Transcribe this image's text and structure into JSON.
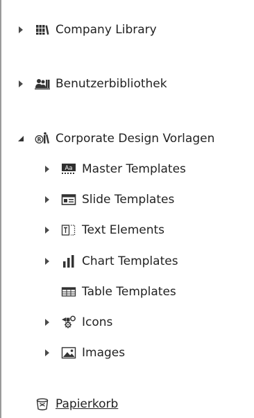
{
  "tree": {
    "libraries": [
      {
        "label": "Company Library",
        "icon": "books-icon",
        "expanded": false
      },
      {
        "label": "Benutzerbibliothek",
        "icon": "users-library-icon",
        "expanded": false
      },
      {
        "label": "Corporate Design Vorlagen",
        "icon": "corporate-design-icon",
        "expanded": true
      }
    ],
    "children": [
      {
        "label": "Master Templates",
        "icon": "master-template-icon",
        "has_children": true
      },
      {
        "label": "Slide Templates",
        "icon": "slide-template-icon",
        "has_children": true
      },
      {
        "label": "Text Elements",
        "icon": "text-elements-icon",
        "has_children": true
      },
      {
        "label": "Chart Templates",
        "icon": "bar-chart-icon",
        "has_children": true
      },
      {
        "label": "Table Templates",
        "icon": "table-icon",
        "has_children": false
      },
      {
        "label": "Icons",
        "icon": "icons-icon",
        "has_children": true
      },
      {
        "label": "Images",
        "icon": "image-icon",
        "has_children": true
      }
    ],
    "trash": {
      "label": "Papierkorb",
      "icon": "trash-icon"
    }
  },
  "colors": {
    "text": "#222222",
    "icon": "#333333",
    "arrow": "#4a4a4a",
    "border": "#9a9a9a"
  }
}
